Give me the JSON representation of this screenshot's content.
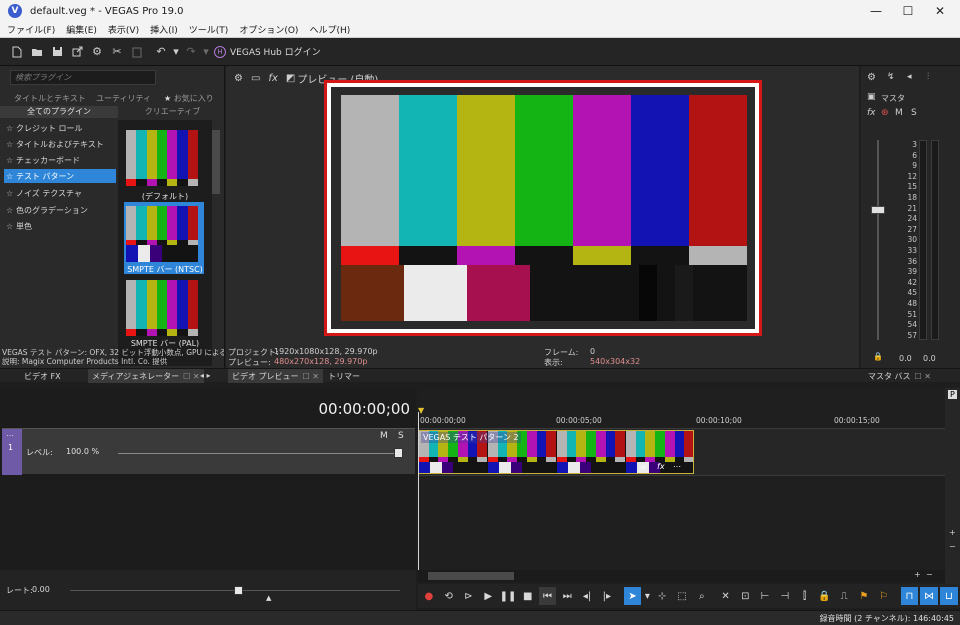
{
  "window": {
    "title": "default.veg * - VEGAS Pro 19.0",
    "logo_letter": "V",
    "controls": [
      "—",
      "☐",
      "✕"
    ]
  },
  "menu": [
    "ファイル(F)",
    "編集(E)",
    "表示(V)",
    "挿入(I)",
    "ツール(T)",
    "オプション(O)",
    "ヘルプ(H)"
  ],
  "toolbar": {
    "hub_logo": "H",
    "hub_label": "VEGAS Hub ログイン",
    "icons": [
      "new-file-icon",
      "open-folder-icon",
      "save-icon",
      "export-icon",
      "settings-icon",
      "cut-icon",
      "paste-icon",
      "undo-icon",
      "redo-icon"
    ]
  },
  "plugin_panel": {
    "search_placeholder": "検索プラグイン",
    "category_tabs": [
      "タイトルとテキスト",
      "ユーティリティ",
      "お気に入り"
    ],
    "group_tabs": [
      "全てのプラグイン",
      "クリエーティブ"
    ],
    "items": [
      {
        "label": "クレジット ロール",
        "selected": false
      },
      {
        "label": "タイトルおよびテキスト",
        "selected": false
      },
      {
        "label": "チェッカーボード",
        "selected": false
      },
      {
        "label": "テスト パターン",
        "selected": true
      },
      {
        "label": "ノイズ テクスチャ",
        "selected": false
      },
      {
        "label": "色のグラデーション",
        "selected": false
      },
      {
        "label": "単色",
        "selected": false
      }
    ],
    "presets": [
      {
        "label": "(デフォルト)",
        "selected": false
      },
      {
        "label": "SMPTE バー (NTSC)",
        "selected": true
      },
      {
        "label": "SMPTE バー (PAL)",
        "selected": false
      }
    ],
    "description_line1": "VEGAS テスト パターン: OFX, 32 ビット浮動小数点, GPU による高速化",
    "description_line2": "説明: Magix Computer Products Intl. Co. 提供"
  },
  "preview": {
    "toolbar_label": "プレビュー (自動)",
    "project_label": "プロジェクト:",
    "project_value": "1920x1080x128, 29.970p",
    "preview_label": "プレビュー:",
    "preview_value": "480x270x128, 29.970p",
    "frame_label": "フレーム:",
    "frame_value": "0",
    "display_label": "表示:",
    "display_value": "540x304x32",
    "top_colors": [
      "#b4b4b4",
      "#13b4b4",
      "#b4b413",
      "#13b413",
      "#b413b4",
      "#1313b4",
      "#b41313"
    ],
    "mid_colors": [
      "#e81313",
      "#131313",
      "#b413b4",
      "#131313",
      "#b4b413",
      "#131313",
      "#b4b4b4"
    ],
    "bottom_colors": [
      "#6b2a10",
      "#ebebeb",
      "#a6104f",
      "#131313",
      "#131313",
      "#070707",
      "#131313",
      "#1a1a1a",
      "#131313"
    ]
  },
  "master": {
    "label": "マスタ",
    "fx": "fx",
    "m": "M",
    "s": "S",
    "scale": [
      "3",
      "6",
      "9",
      "12",
      "15",
      "18",
      "21",
      "24",
      "27",
      "30",
      "33",
      "36",
      "39",
      "42",
      "45",
      "48",
      "51",
      "54",
      "57"
    ],
    "left_value": "0.0",
    "right_value": "0.0"
  },
  "window_tabs": [
    {
      "label": "ビデオ FX",
      "active": false
    },
    {
      "label": "メディアジェネレーター",
      "active": true
    },
    {
      "label": "ビデオ プレビュー",
      "active": true
    },
    {
      "label": "トリマー",
      "active": false
    },
    {
      "label": "マスタ バス",
      "active": false
    }
  ],
  "timeline": {
    "timecode": "00:00:00;00",
    "track": {
      "number": "1",
      "level_label": "レベル:",
      "level_value": "100.0 %",
      "m": "M",
      "s": "S"
    },
    "ruler_labels": [
      "00:00:00;00",
      "00:00:05;00",
      "00:00:10;00",
      "00:00:15;00"
    ],
    "clip_title": "VEGAS テスト パターン 2",
    "rate_label": "レート:",
    "rate_value": "0.00"
  },
  "status": {
    "text": "録音時間 (2 チャンネル): 146:40:45"
  }
}
